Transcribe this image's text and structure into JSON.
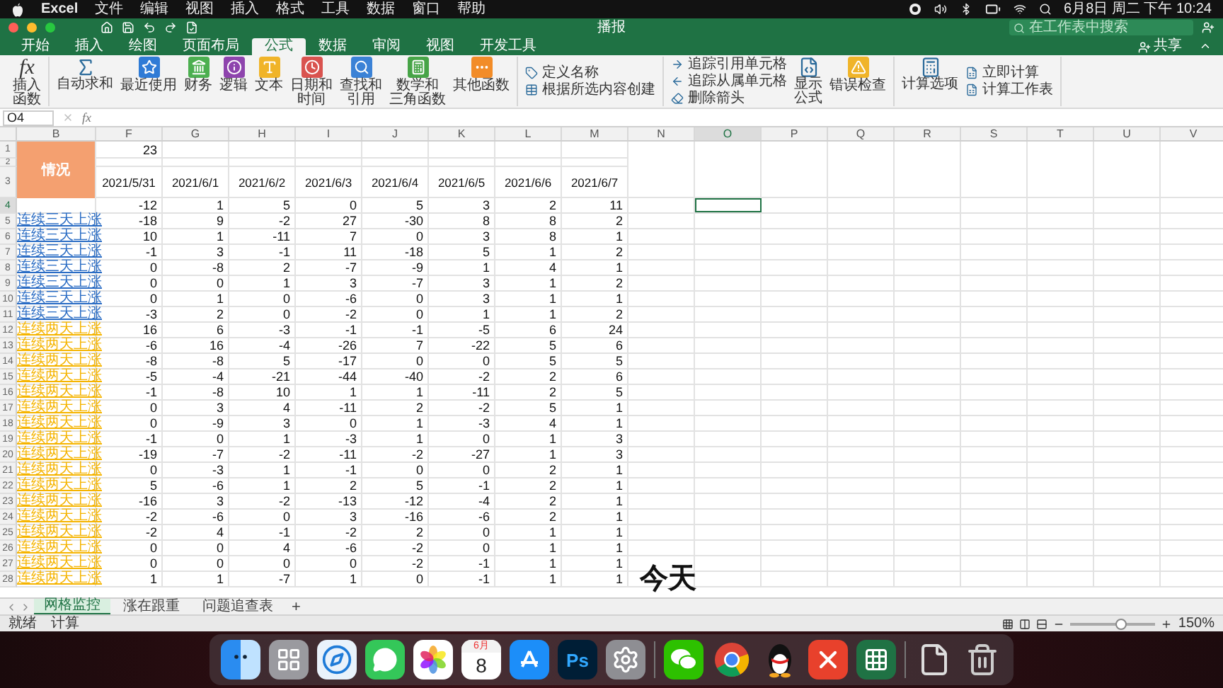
{
  "menu_bar": {
    "app": "Excel",
    "items": [
      "文件",
      "编辑",
      "视图",
      "插入",
      "格式",
      "工具",
      "数据",
      "窗口",
      "帮助"
    ],
    "clock": "6月8日 周二 下午 10:24"
  },
  "window": {
    "title": "播报",
    "search": {
      "placeholder": "在工作表中搜索"
    },
    "share": "共享"
  },
  "ribbon_tabs": [
    {
      "label": "开始",
      "selected": false
    },
    {
      "label": "插入",
      "selected": false
    },
    {
      "label": "绘图",
      "selected": false
    },
    {
      "label": "页面布局",
      "selected": false
    },
    {
      "label": "公式",
      "selected": true
    },
    {
      "label": "数据",
      "selected": false
    },
    {
      "label": "审阅",
      "selected": false
    },
    {
      "label": "视图",
      "selected": false
    },
    {
      "label": "开发工具",
      "selected": false
    }
  ],
  "ribbon": [
    {
      "items": [
        {
          "kind": "function",
          "lines": [
            "插入",
            "函数"
          ],
          "glyph": "fx"
        }
      ]
    },
    {
      "items": [
        {
          "kind": "sigma",
          "label": "自动求和"
        },
        {
          "kind": "star",
          "label": "最近使用",
          "color": "#2f7bd6"
        },
        {
          "kind": "finance",
          "label": "财务",
          "color": "#4caf50"
        },
        {
          "kind": "logic",
          "label": "逻辑",
          "color": "#8e44ad"
        },
        {
          "kind": "text",
          "label": "文本",
          "color": "#f0b429"
        },
        {
          "kind": "date",
          "lines": [
            "日期和",
            "时间"
          ],
          "color": "#d9534f"
        },
        {
          "kind": "lookup",
          "lines": [
            "查找和",
            "引用"
          ],
          "color": "#3b82d6"
        },
        {
          "kind": "math",
          "lines": [
            "数学和",
            "三角函数"
          ],
          "color": "#47a447"
        },
        {
          "kind": "more",
          "label": "其他函数",
          "color": "#f28c28"
        }
      ]
    },
    {
      "items": [
        {
          "kind": "stack",
          "buttons": [
            {
              "kind": "tag",
              "label": "定义名称"
            },
            {
              "kind": "table",
              "label": "根据所选内容创建"
            }
          ]
        }
      ]
    },
    {
      "items": [
        {
          "kind": "stack",
          "buttons": [
            {
              "kind": "arrow-right",
              "label": "追踪引用单元格"
            },
            {
              "kind": "arrow-left",
              "label": "追踪从属单元格"
            },
            {
              "kind": "eraser",
              "label": "删除箭头"
            }
          ]
        },
        {
          "kind": "formula",
          "lines": [
            "显示",
            "公式"
          ]
        },
        {
          "kind": "warning",
          "label": "错误检查",
          "color": "#f0b429"
        }
      ]
    },
    {
      "items": [
        {
          "kind": "calc",
          "label": "计算选项"
        },
        {
          "kind": "stack",
          "buttons": [
            {
              "kind": "sheet",
              "label": "立即计算"
            },
            {
              "kind": "sheet",
              "label": "计算工作表"
            }
          ]
        }
      ]
    }
  ],
  "formula_bar": {
    "name_box": "O4",
    "glyph": "fx"
  },
  "columns": [
    {
      "label": "B",
      "kind": "wide",
      "selected": false
    },
    {
      "label": "F",
      "kind": "normal",
      "selected": false
    },
    {
      "label": "G",
      "kind": "normal",
      "selected": false
    },
    {
      "label": "H",
      "kind": "normal",
      "selected": false
    },
    {
      "label": "I",
      "kind": "normal",
      "selected": false
    },
    {
      "label": "J",
      "kind": "normal",
      "selected": false
    },
    {
      "label": "K",
      "kind": "normal",
      "selected": false
    },
    {
      "label": "L",
      "kind": "normal",
      "selected": false
    },
    {
      "label": "M",
      "kind": "normal",
      "selected": false
    },
    {
      "label": "N",
      "kind": "normal",
      "selected": false
    },
    {
      "label": "O",
      "kind": "normal",
      "selected": true
    },
    {
      "label": "P",
      "kind": "normal",
      "selected": false
    },
    {
      "label": "Q",
      "kind": "normal",
      "selected": false
    },
    {
      "label": "R",
      "kind": "normal",
      "selected": false
    },
    {
      "label": "S",
      "kind": "normal",
      "selected": false
    },
    {
      "label": "T",
      "kind": "normal",
      "selected": false
    },
    {
      "label": "U",
      "kind": "normal",
      "selected": false
    },
    {
      "label": "V",
      "kind": "normal",
      "selected": false
    }
  ],
  "header_rows": {
    "row_numbers": [
      "1",
      "2",
      "3"
    ],
    "label": "情况",
    "top_value": "23",
    "dates": [
      "2021/5/31",
      "2021/6/1",
      "2021/6/2",
      "2021/6/3",
      "2021/6/4",
      "2021/6/5",
      "2021/6/6",
      "2021/6/7"
    ]
  },
  "rows": [
    {
      "num": "4",
      "selected": true,
      "values": [
        "-12",
        "1",
        "5",
        "0",
        "5",
        "3",
        "2",
        "11"
      ]
    },
    {
      "num": "5",
      "selected": false,
      "label": "连续三天上涨",
      "color": "#2a6cc4",
      "values": [
        "-18",
        "9",
        "-2",
        "27",
        "-30",
        "8",
        "8",
        "2"
      ]
    },
    {
      "num": "6",
      "selected": false,
      "label": "连续三天上涨",
      "color": "#2a6cc4",
      "values": [
        "10",
        "1",
        "-11",
        "7",
        "0",
        "3",
        "8",
        "1"
      ]
    },
    {
      "num": "7",
      "selected": false,
      "label": "连续三天上涨",
      "color": "#2a6cc4",
      "values": [
        "-1",
        "3",
        "-1",
        "11",
        "-18",
        "5",
        "1",
        "2"
      ]
    },
    {
      "num": "8",
      "selected": false,
      "label": "连续三天上涨",
      "color": "#2a6cc4",
      "values": [
        "0",
        "-8",
        "2",
        "-7",
        "-9",
        "1",
        "4",
        "1"
      ]
    },
    {
      "num": "9",
      "selected": false,
      "label": "连续三天上涨",
      "color": "#2a6cc4",
      "values": [
        "0",
        "0",
        "1",
        "3",
        "-7",
        "3",
        "1",
        "2"
      ]
    },
    {
      "num": "10",
      "selected": false,
      "label": "连续三天上涨",
      "color": "#2a6cc4",
      "values": [
        "0",
        "1",
        "0",
        "-6",
        "0",
        "3",
        "1",
        "1"
      ]
    },
    {
      "num": "11",
      "selected": false,
      "label": "连续三天上涨",
      "color": "#2a6cc4",
      "values": [
        "-3",
        "2",
        "0",
        "-2",
        "0",
        "1",
        "1",
        "2"
      ]
    },
    {
      "num": "12",
      "selected": false,
      "label": "连续两天上涨",
      "color": "#f5b400",
      "values": [
        "16",
        "6",
        "-3",
        "-1",
        "-1",
        "-5",
        "6",
        "24"
      ]
    },
    {
      "num": "13",
      "selected": false,
      "label": "连续两天上涨",
      "color": "#f5b400",
      "values": [
        "-6",
        "16",
        "-4",
        "-26",
        "7",
        "-22",
        "5",
        "6"
      ]
    },
    {
      "num": "14",
      "selected": false,
      "label": "连续两天上涨",
      "color": "#f5b400",
      "values": [
        "-8",
        "-8",
        "5",
        "-17",
        "0",
        "0",
        "5",
        "5"
      ]
    },
    {
      "num": "15",
      "selected": false,
      "label": "连续两天上涨",
      "color": "#f5b400",
      "values": [
        "-5",
        "-4",
        "-21",
        "-44",
        "-40",
        "-2",
        "2",
        "6"
      ]
    },
    {
      "num": "16",
      "selected": false,
      "label": "连续两天上涨",
      "color": "#f5b400",
      "values": [
        "-1",
        "-8",
        "10",
        "1",
        "1",
        "-11",
        "2",
        "5"
      ]
    },
    {
      "num": "17",
      "selected": false,
      "label": "连续两天上涨",
      "color": "#f5b400",
      "values": [
        "0",
        "3",
        "4",
        "-11",
        "2",
        "-2",
        "5",
        "1"
      ]
    },
    {
      "num": "18",
      "selected": false,
      "label": "连续两天上涨",
      "color": "#f5b400",
      "values": [
        "0",
        "-9",
        "3",
        "0",
        "1",
        "-3",
        "4",
        "1"
      ]
    },
    {
      "num": "19",
      "selected": false,
      "label": "连续两天上涨",
      "color": "#f5b400",
      "values": [
        "-1",
        "0",
        "1",
        "-3",
        "1",
        "0",
        "1",
        "3"
      ]
    },
    {
      "num": "20",
      "selected": false,
      "label": "连续两天上涨",
      "color": "#f5b400",
      "values": [
        "-19",
        "-7",
        "-2",
        "-11",
        "-2",
        "-27",
        "1",
        "3"
      ]
    },
    {
      "num": "21",
      "selected": false,
      "label": "连续两天上涨",
      "color": "#f5b400",
      "values": [
        "0",
        "-3",
        "1",
        "-1",
        "0",
        "0",
        "2",
        "1"
      ]
    },
    {
      "num": "22",
      "selected": false,
      "label": "连续两天上涨",
      "color": "#f5b400",
      "values": [
        "5",
        "-6",
        "1",
        "2",
        "5",
        "-1",
        "2",
        "1"
      ]
    },
    {
      "num": "23",
      "selected": false,
      "label": "连续两天上涨",
      "color": "#f5b400",
      "values": [
        "-16",
        "3",
        "-2",
        "-13",
        "-12",
        "-4",
        "2",
        "1"
      ]
    },
    {
      "num": "24",
      "selected": false,
      "label": "连续两天上涨",
      "color": "#f5b400",
      "values": [
        "-2",
        "-6",
        "0",
        "3",
        "-16",
        "-6",
        "2",
        "1"
      ]
    },
    {
      "num": "25",
      "selected": false,
      "label": "连续两天上涨",
      "color": "#f5b400",
      "values": [
        "-2",
        "4",
        "-1",
        "-2",
        "2",
        "0",
        "1",
        "1"
      ]
    },
    {
      "num": "26",
      "selected": false,
      "label": "连续两天上涨",
      "color": "#f5b400",
      "values": [
        "0",
        "0",
        "4",
        "-6",
        "-2",
        "0",
        "1",
        "1"
      ]
    },
    {
      "num": "27",
      "selected": false,
      "label": "连续两天上涨",
      "color": "#f5b400",
      "values": [
        "0",
        "0",
        "0",
        "0",
        "-2",
        "-1",
        "1",
        "1"
      ]
    },
    {
      "num": "28",
      "selected": false,
      "label": "连续两天上涨",
      "color": "#f5b400",
      "values": [
        "1",
        "1",
        "-7",
        "1",
        "0",
        "-1",
        "1",
        "1"
      ]
    }
  ],
  "subtitle": "今天",
  "sheet_tabs": [
    {
      "label": "网格监控",
      "selected": true
    },
    {
      "label": "涨在跟重",
      "selected": false
    },
    {
      "label": "问题追查表",
      "selected": false
    }
  ],
  "add_sheet": "+",
  "status_bar": {
    "items": [
      "就绪",
      "计算"
    ],
    "zoom": {
      "reading": "150%",
      "level": 0.6
    }
  },
  "dock": [
    {
      "kind": "finder"
    },
    {
      "kind": "launchpad"
    },
    {
      "kind": "safari"
    },
    {
      "kind": "messages"
    },
    {
      "kind": "photos"
    },
    {
      "kind": "calendar",
      "month": "6月",
      "day": "8"
    },
    {
      "kind": "appstore"
    },
    {
      "kind": "photoshop",
      "glyph": "Ps"
    },
    {
      "kind": "settings"
    },
    {
      "kind": "divider"
    },
    {
      "kind": "wechat"
    },
    {
      "kind": "chrome"
    },
    {
      "kind": "penguin"
    },
    {
      "kind": "xmind"
    },
    {
      "kind": "excel"
    },
    {
      "kind": "divider"
    },
    {
      "kind": "file"
    },
    {
      "kind": "trash"
    }
  ]
}
